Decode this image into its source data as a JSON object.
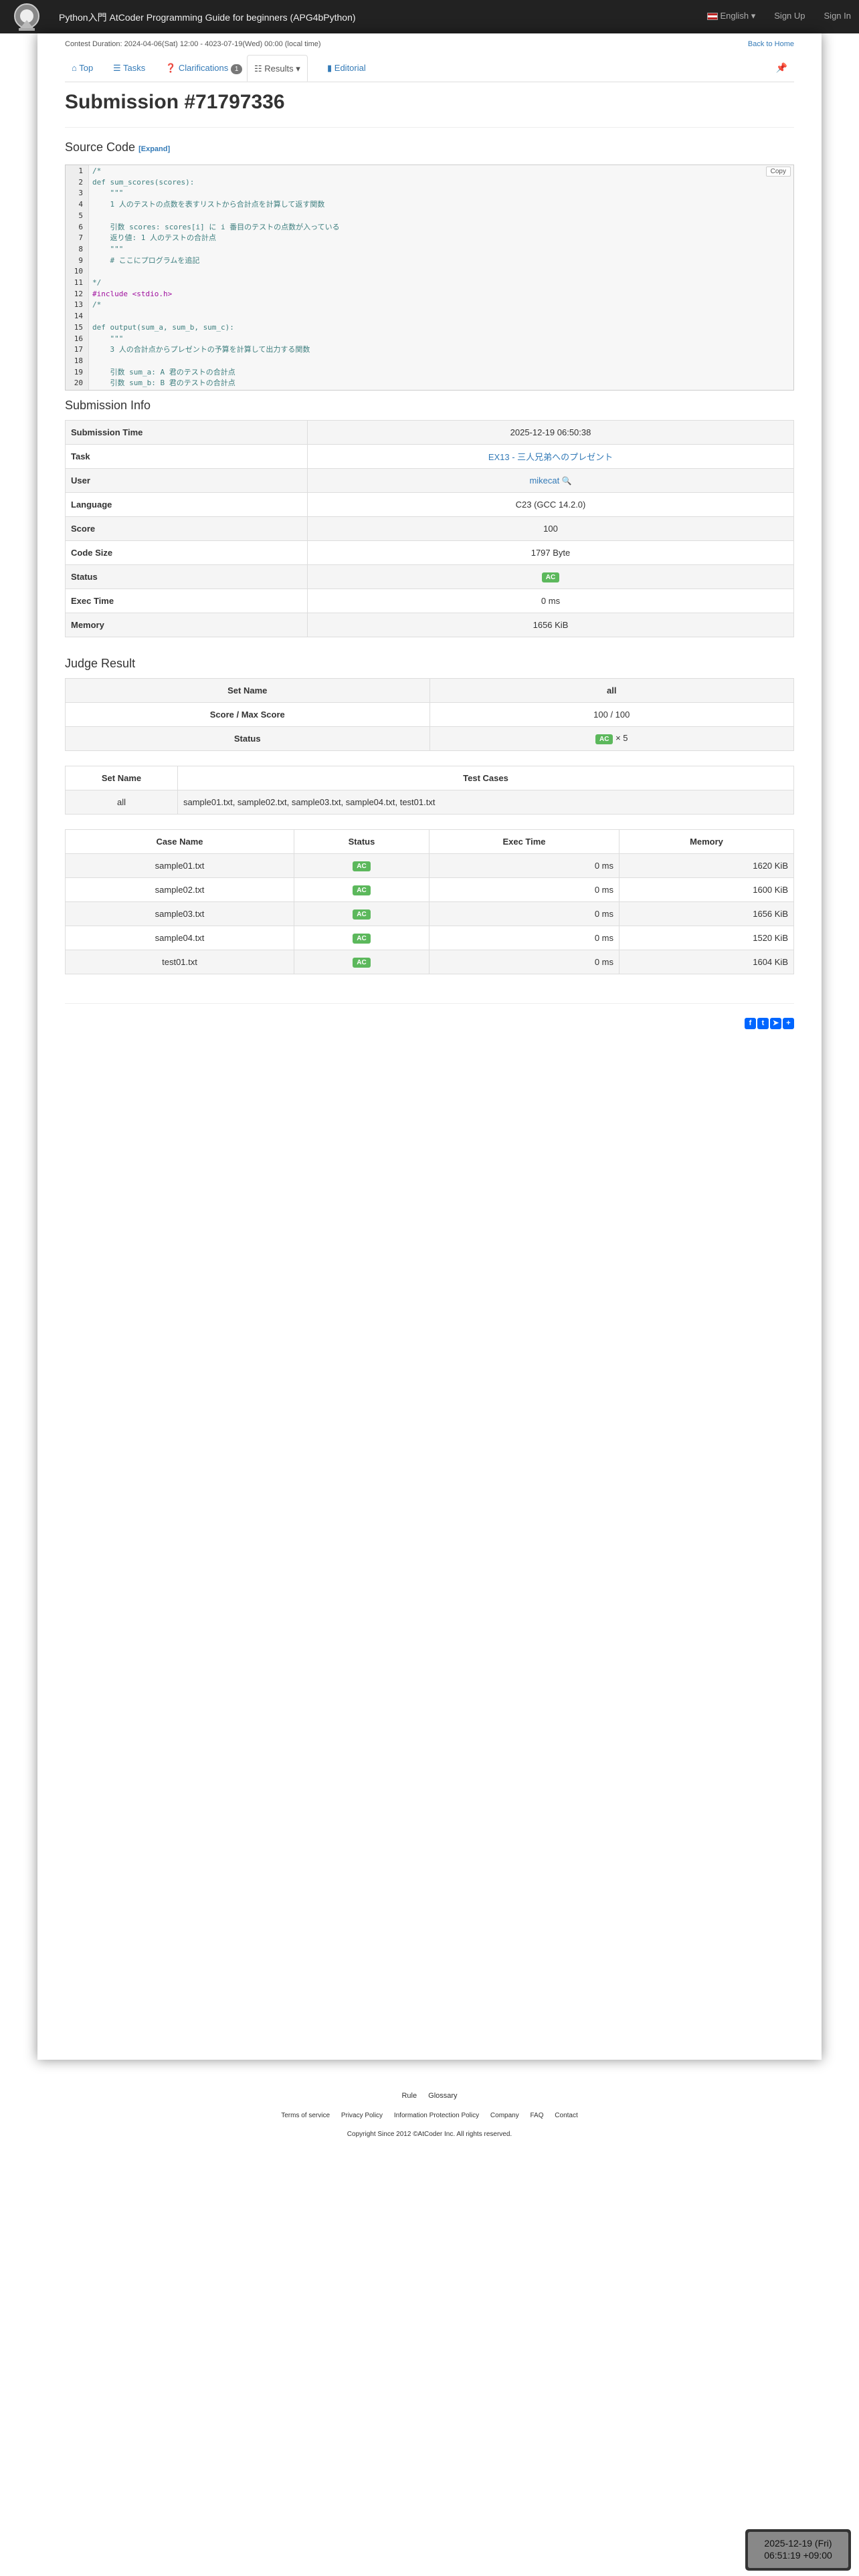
{
  "navbar": {
    "brand": "Python入門 AtCoder Programming Guide for beginners (APG4bPython)",
    "language": "English",
    "signup": "Sign Up",
    "signin": "Sign In"
  },
  "contest": {
    "duration": "Contest Duration: 2024-04-06(Sat) 12:00 - 4023-07-19(Wed) 00:00 (local time)",
    "back_home": "Back to Home"
  },
  "tabs": {
    "top": "Top",
    "tasks": "Tasks",
    "clarifications": "Clarifications",
    "clarifications_count": "1",
    "results": "Results",
    "editorial": "Editorial"
  },
  "submission": {
    "title": "Submission #71797336"
  },
  "source": {
    "title": "Source Code",
    "expand": "[Expand]",
    "copy": "Copy",
    "lines": [
      {
        "n": "1",
        "t": "/*",
        "c": "com"
      },
      {
        "n": "2",
        "t": "def sum_scores(scores):",
        "c": "com"
      },
      {
        "n": "3",
        "t": "    \"\"\"",
        "c": "com"
      },
      {
        "n": "4",
        "t": "    1 人のテストの点数を表すリストから合計点を計算して返す関数",
        "c": "com"
      },
      {
        "n": "5",
        "t": "",
        "c": "com"
      },
      {
        "n": "6",
        "t": "    引数 scores: scores[i] に i 番目のテストの点数が入っている",
        "c": "com"
      },
      {
        "n": "7",
        "t": "    返り値: 1 人のテストの合計点",
        "c": "com"
      },
      {
        "n": "8",
        "t": "    \"\"\"",
        "c": "com"
      },
      {
        "n": "9",
        "t": "    # ここにプログラムを追記",
        "c": "com"
      },
      {
        "n": "10",
        "t": "",
        "c": "com"
      },
      {
        "n": "11",
        "t": "*/",
        "c": "com"
      },
      {
        "n": "12",
        "t": "#include <stdio.h>",
        "c": "pp"
      },
      {
        "n": "13",
        "t": "/*",
        "c": "com"
      },
      {
        "n": "14",
        "t": "",
        "c": "com"
      },
      {
        "n": "15",
        "t": "def output(sum_a, sum_b, sum_c):",
        "c": "com"
      },
      {
        "n": "16",
        "t": "    \"\"\"",
        "c": "com"
      },
      {
        "n": "17",
        "t": "    3 人の合計点からプレゼントの予算を計算して出力する関数",
        "c": "com"
      },
      {
        "n": "18",
        "t": "",
        "c": "com"
      },
      {
        "n": "19",
        "t": "    引数 sum_a: A 君のテストの合計点",
        "c": "com"
      },
      {
        "n": "20",
        "t": "    引数 sum_b: B 君のテストの合計点",
        "c": "com"
      }
    ]
  },
  "info": {
    "title": "Submission Info",
    "rows": [
      {
        "k": "Submission Time",
        "v": "2025-12-19 06:50:38"
      },
      {
        "k": "Task",
        "v": "EX13 - 三人兄弟へのプレゼント"
      },
      {
        "k": "User",
        "v": "mikecat"
      },
      {
        "k": "Language",
        "v": "C23 (GCC 14.2.0)"
      },
      {
        "k": "Score",
        "v": "100"
      },
      {
        "k": "Code Size",
        "v": "1797 Byte"
      },
      {
        "k": "Status",
        "v": "AC"
      },
      {
        "k": "Exec Time",
        "v": "0 ms"
      },
      {
        "k": "Memory",
        "v": "1656 KiB"
      }
    ]
  },
  "judge": {
    "title": "Judge Result",
    "set_name_label": "Set Name",
    "set_name": "all",
    "score_label": "Score / Max Score",
    "score": "100 / 100",
    "status_label": "Status",
    "status": "AC",
    "status_count": "× 5"
  },
  "sets": {
    "headers": [
      "Set Name",
      "Test Cases"
    ],
    "rows": [
      {
        "name": "all",
        "cases": "sample01.txt, sample02.txt, sample03.txt, sample04.txt, test01.txt"
      }
    ]
  },
  "cases": {
    "headers": [
      "Case Name",
      "Status",
      "Exec Time",
      "Memory"
    ],
    "rows": [
      {
        "name": "sample01.txt",
        "status": "AC",
        "time": "0 ms",
        "mem": "1620 KiB"
      },
      {
        "name": "sample02.txt",
        "status": "AC",
        "time": "0 ms",
        "mem": "1600 KiB"
      },
      {
        "name": "sample03.txt",
        "status": "AC",
        "time": "0 ms",
        "mem": "1656 KiB"
      },
      {
        "name": "sample04.txt",
        "status": "AC",
        "time": "0 ms",
        "mem": "1520 KiB"
      },
      {
        "name": "test01.txt",
        "status": "AC",
        "time": "0 ms",
        "mem": "1604 KiB"
      }
    ]
  },
  "footer": {
    "rule": "Rule",
    "glossary": "Glossary",
    "links": [
      "Terms of service",
      "Privacy Policy",
      "Information Protection Policy",
      "Company",
      "FAQ",
      "Contact"
    ],
    "copyright": "Copyright Since 2012 ©AtCoder Inc. All rights reserved."
  },
  "clock": {
    "date": "2025-12-19 (Fri)",
    "time": "06:51:19 +09:00"
  },
  "colors": {
    "accent": "#337ab7",
    "ac": "#5cb85c",
    "navbar": "#222222"
  }
}
